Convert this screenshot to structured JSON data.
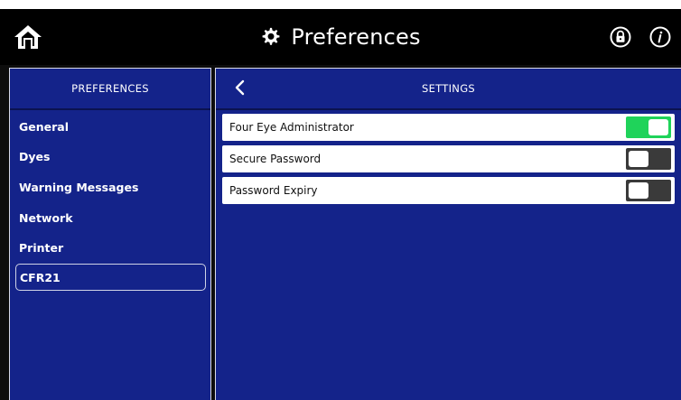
{
  "header": {
    "title": "Preferences",
    "icons": {
      "home": "home-icon",
      "gear": "gear-icon",
      "lock": "lock-icon",
      "info": "info-icon"
    }
  },
  "sidebar": {
    "heading": "PREFERENCES",
    "items": [
      {
        "label": "General",
        "selected": false
      },
      {
        "label": "Dyes",
        "selected": false
      },
      {
        "label": "Warning Messages",
        "selected": false
      },
      {
        "label": "Network",
        "selected": false
      },
      {
        "label": "Printer",
        "selected": false
      },
      {
        "label": "CFR21",
        "selected": true
      }
    ]
  },
  "main": {
    "heading": "SETTINGS",
    "back_icon": "chevron-left-icon",
    "settings": [
      {
        "label": "Four Eye Administrator",
        "enabled": true
      },
      {
        "label": "Secure Password",
        "enabled": false
      },
      {
        "label": "Password Expiry",
        "enabled": false
      }
    ]
  },
  "colors": {
    "panel": "#14238a",
    "header": "#000000",
    "toggle_on": "#1fd35a",
    "toggle_off": "#3a3a3a"
  }
}
